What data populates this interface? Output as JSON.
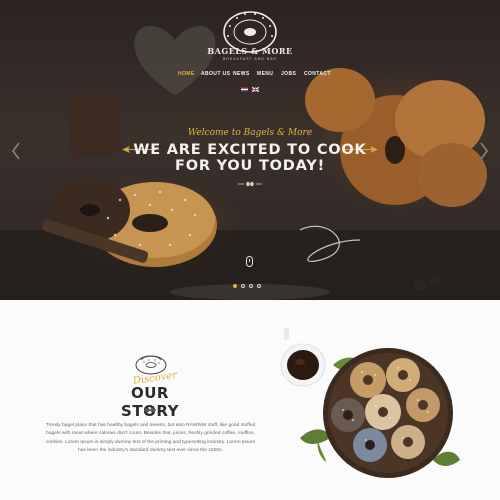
{
  "brand": {
    "name": "BAGELS & MORE",
    "tagline": "BREAKFAST AND BAR"
  },
  "nav": {
    "items": [
      {
        "label": "HOME",
        "active": true
      },
      {
        "label": "ABOUT US",
        "active": false
      },
      {
        "label": "NEWS",
        "active": false
      },
      {
        "label": "MENU",
        "active": false
      },
      {
        "label": "JOBS",
        "active": false
      },
      {
        "label": "CONTACT",
        "active": false
      }
    ],
    "languages": [
      "NL",
      "EN"
    ]
  },
  "hero": {
    "welcome": "Welcome to Bagels & More",
    "headline_line1": "WE ARE EXCITED TO COOK",
    "headline_line2": "FOR YOU TODAY!",
    "slides_total": 4,
    "current_slide": 1
  },
  "story": {
    "script": "Discover",
    "title": "OUR STORY",
    "body": "Trendy bagel place that has healthy bagels and sweets, but also RAWWW stuff, like good stuffed bagels with meat where calories don't count. Besides that, juices, freshly grinded coffee, muffins, cookies. Lorem Ipsum is simply dummy text of the printing and typesetting industry. Lorem Ipsum has been the industry's standard dummy text ever since the 1500s."
  },
  "colors": {
    "accent": "#e2b23c",
    "hero_dark": "#2a2320",
    "story_bg": "#fbfbfb",
    "heading": "#2b2b2b",
    "body_text": "#6a6a6a"
  }
}
